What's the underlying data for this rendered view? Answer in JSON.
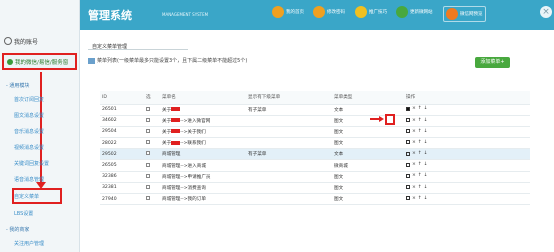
{
  "header": {
    "title": "管理系统",
    "subtitle": "MANAGEMENT SYSTEM",
    "nav": [
      {
        "label": "我的首页",
        "icon": "home-icon",
        "color": "#f0a020"
      },
      {
        "label": "修改密码",
        "icon": "lock-icon",
        "color": "#f0a020"
      },
      {
        "label": "推广技巧",
        "icon": "bulb-icon",
        "color": "#f0c020"
      },
      {
        "label": "更新微网站",
        "icon": "globe-icon",
        "color": "#48a83e"
      },
      {
        "label": "微信网预览",
        "icon": "preview-icon",
        "color": "#f07a20"
      }
    ],
    "close_glyph": "×"
  },
  "sidebar": {
    "account_label": "我的账号",
    "section_label": "我的微信/易信/服务窗",
    "group1_label": "- 通用模块",
    "items": [
      "首次订阅回复",
      "图文消息设置",
      "音乐消息设置",
      "视频消息设置",
      "关键词回复设置",
      "语音消息管理",
      "自定义菜单",
      "LBS设置"
    ],
    "group2_label": "- 我的商家",
    "group2_item": "关注用户管理"
  },
  "main": {
    "page_title": "自定义菜单管理",
    "notice": "菜单列表(一级菜单最多只能设置3个，且下属二级菜单不能超过5个)",
    "add_button": "添加菜单+",
    "columns": [
      "ID",
      "选",
      "菜单名",
      "显示有下级菜单",
      "菜单类型",
      "操作"
    ],
    "rows": [
      {
        "id": "26501",
        "name": "关于",
        "name_redacted": true,
        "parent": "有子菜单",
        "type": "文本",
        "highlight": false,
        "op_marked": true
      },
      {
        "id": "34602",
        "name": "关于",
        "name_redacted": true,
        "name_suffix": "-->进入微官网",
        "parent": "",
        "type": "图文",
        "highlight": false,
        "op_marked": false
      },
      {
        "id": "29504",
        "name": "关于",
        "name_redacted": true,
        "name_suffix": "-->关于我们",
        "parent": "",
        "type": "图文",
        "highlight": false,
        "op_marked": false
      },
      {
        "id": "28022",
        "name": "关于",
        "name_redacted": true,
        "name_suffix": "-->联系我们",
        "parent": "",
        "type": "图文",
        "highlight": false,
        "op_marked": false
      },
      {
        "id": "29502",
        "name": "商城管理",
        "name_redacted": false,
        "parent": "有子菜单",
        "type": "文本",
        "highlight": true,
        "op_marked": false
      },
      {
        "id": "26505",
        "name": "商城管理-->进入商城",
        "name_redacted": false,
        "parent": "",
        "type": "微商城",
        "highlight": false,
        "op_marked": false
      },
      {
        "id": "32386",
        "name": "商城管理-->申请推广员",
        "name_redacted": false,
        "parent": "",
        "type": "图文",
        "highlight": false,
        "op_marked": false
      },
      {
        "id": "32381",
        "name": "商城管理-->消费查询",
        "name_redacted": false,
        "parent": "",
        "type": "图文",
        "highlight": false,
        "op_marked": false
      },
      {
        "id": "27940",
        "name": "商城管理-->我的订单",
        "name_redacted": false,
        "parent": "",
        "type": "图文",
        "highlight": false,
        "op_marked": false
      }
    ],
    "ops_glyphs": [
      "✎",
      "×",
      "↑",
      "↓"
    ]
  }
}
